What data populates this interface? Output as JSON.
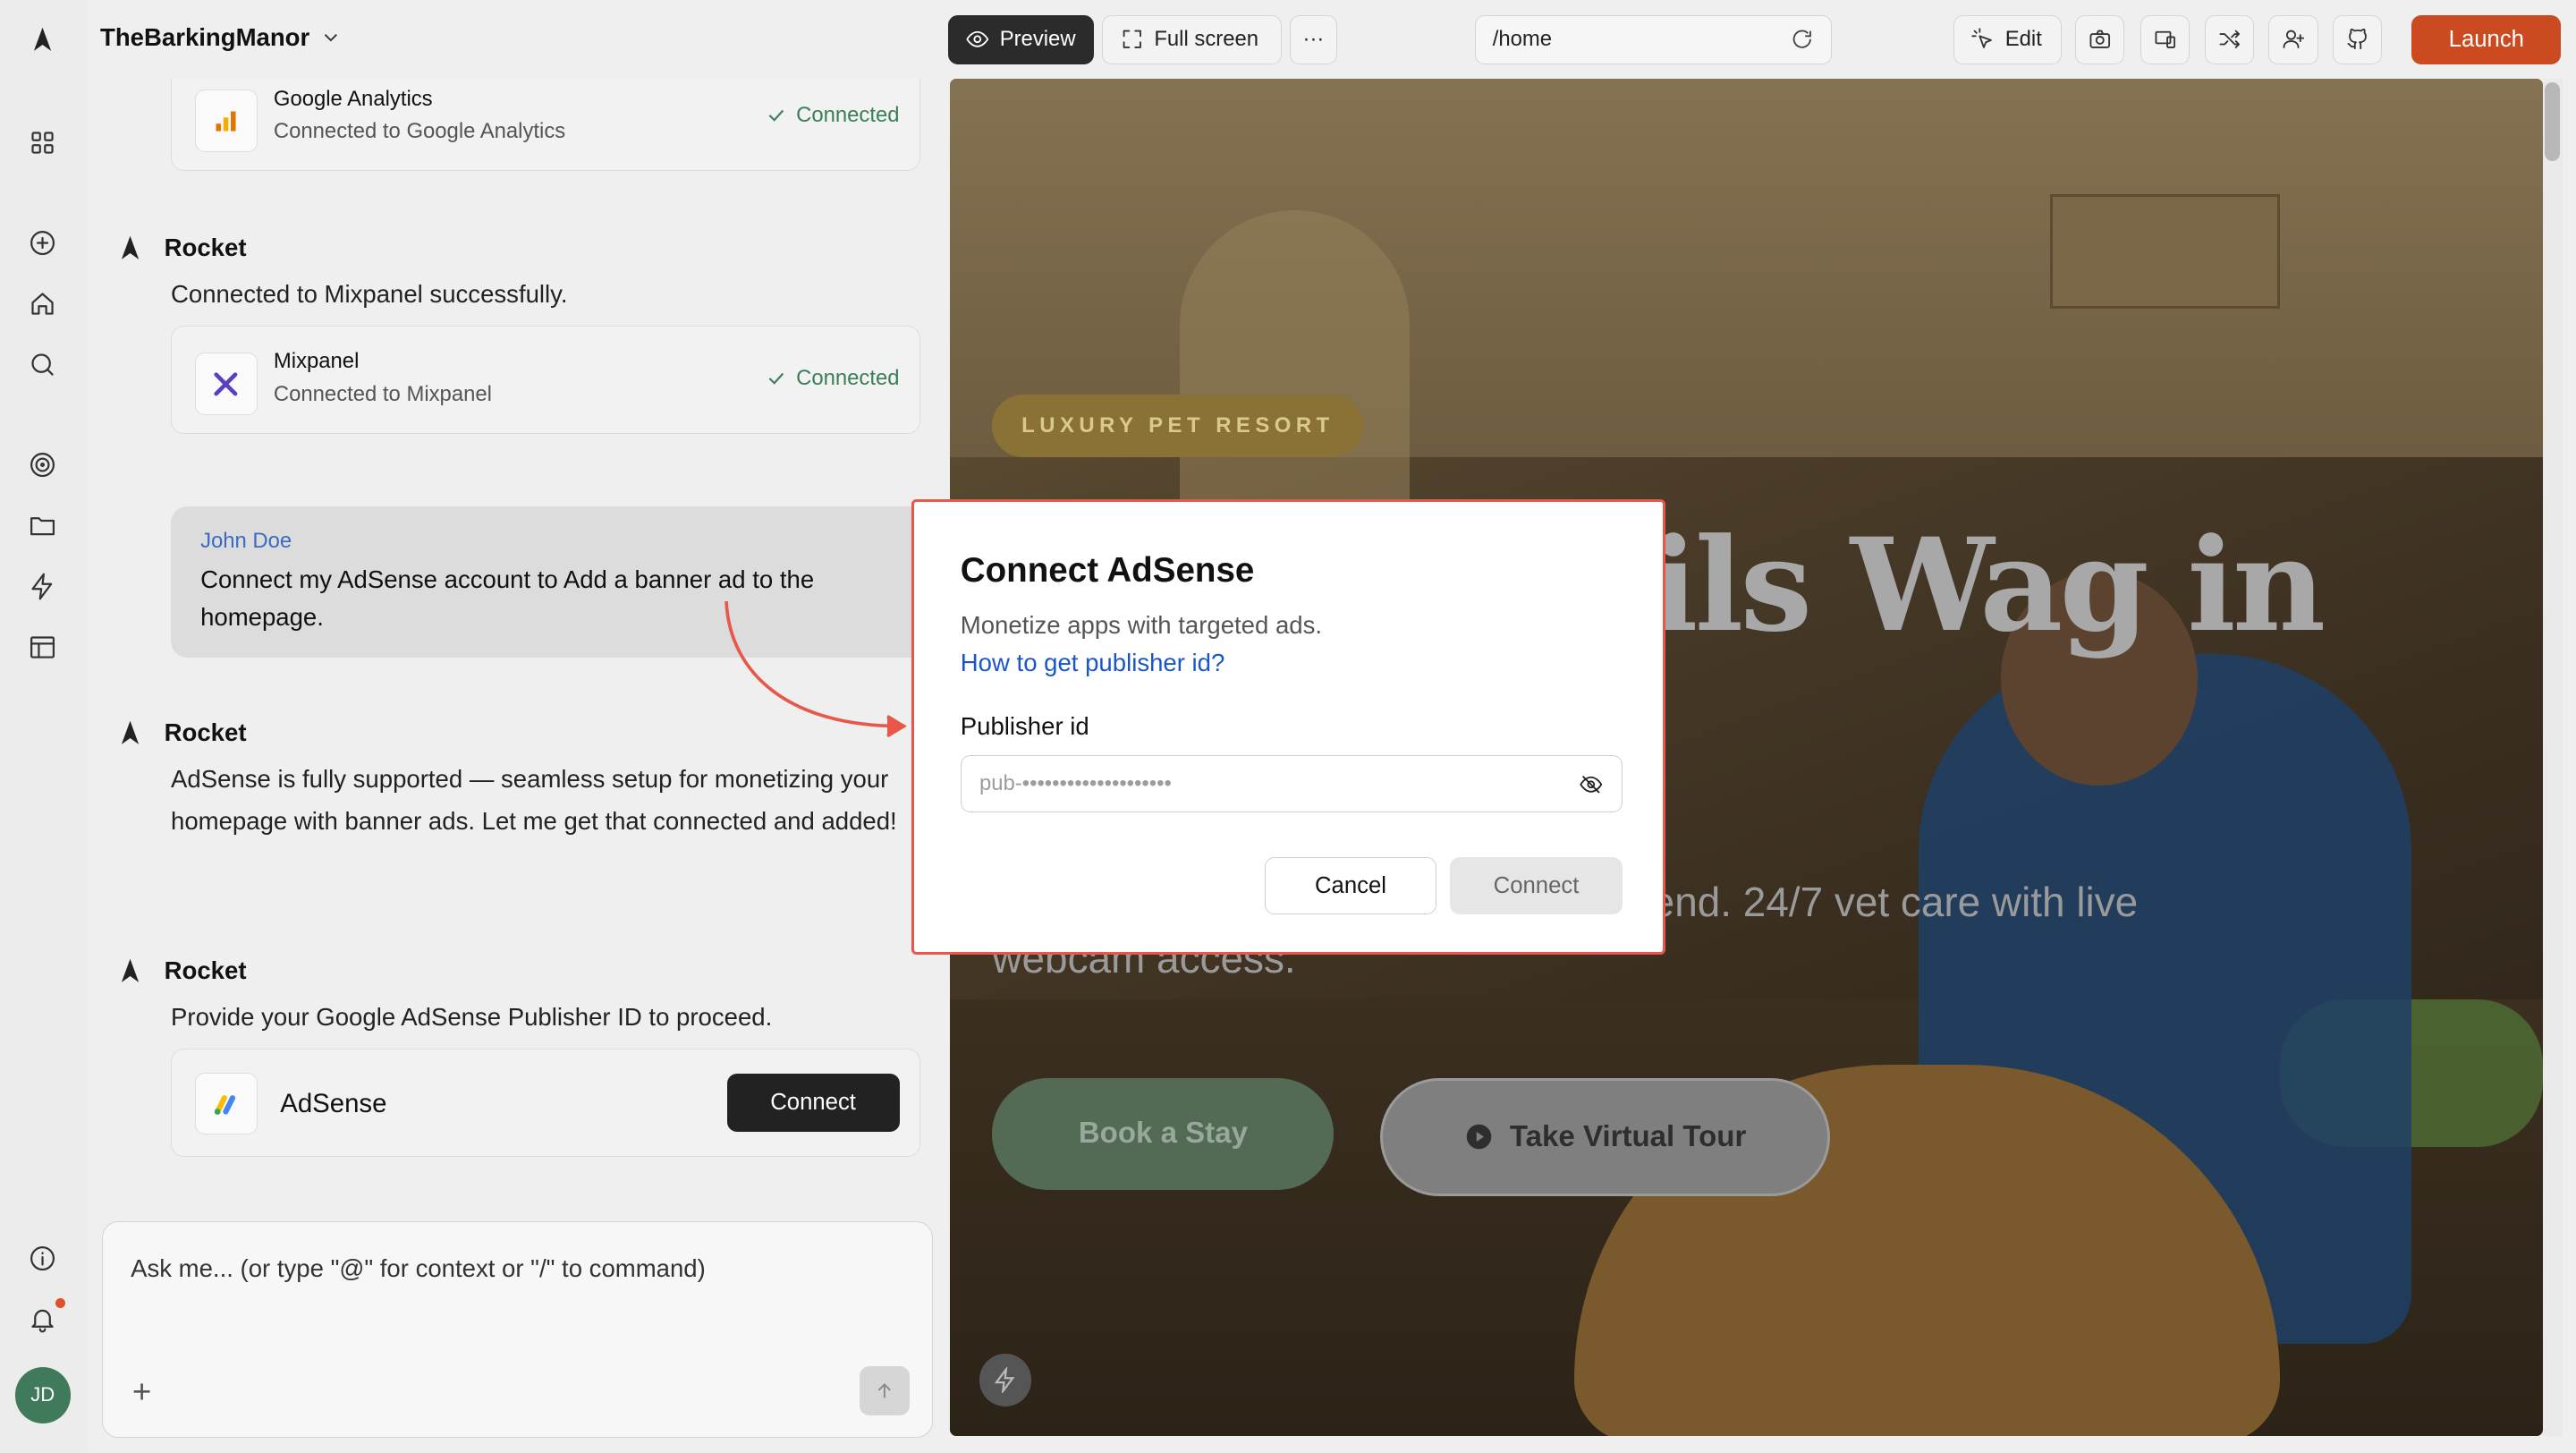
{
  "app": {
    "project_name": "TheBarkingManor",
    "user_initials": "JD"
  },
  "toolbar": {
    "preview_label": "Preview",
    "fullscreen_label": "Full screen",
    "more_label": "···",
    "url": "/home",
    "edit_label": "Edit",
    "launch_label": "Launch"
  },
  "chat": {
    "cards": [
      {
        "title": "Google Analytics",
        "subtitle": "Connected to Google Analytics",
        "status": "Connected"
      },
      {
        "title": "Mixpanel",
        "subtitle": "Connected to Mixpanel",
        "status": "Connected"
      }
    ],
    "bot_name": "Rocket",
    "messages": [
      "Connected to Mixpanel successfully.",
      "AdSense is fully supported — seamless setup for monetizing your homepage with banner ads. Let me get that connected and added!",
      "Provide your Google AdSense Publisher ID to proceed."
    ],
    "user": {
      "name": "John Doe",
      "text": "Connect my AdSense account to Add a banner ad to the homepage."
    },
    "adsense_card": {
      "title": "AdSense",
      "button": "Connect"
    },
    "input_placeholder": "Ask me... (or type \"@\" for context or \"/\" to command)"
  },
  "preview": {
    "badge": "LUXURY PET RESORT",
    "hero_fragment": "ils Wag in",
    "subtitle": "and resort-style care for your best friend. 24/7 vet care with live webcam access.",
    "book_button": "Book a Stay",
    "tour_button": "Take Virtual Tour"
  },
  "modal": {
    "title": "Connect AdSense",
    "description": "Monetize apps with targeted ads.",
    "link": "How to get publisher id?",
    "field_label": "Publisher id",
    "field_placeholder": "pub-••••••••••••••••••••",
    "cancel_label": "Cancel",
    "connect_label": "Connect"
  },
  "colors": {
    "launch": "#cc4a1f",
    "connected": "#3a7f57",
    "link": "#1a56c9",
    "highlight": "#e8574a"
  }
}
